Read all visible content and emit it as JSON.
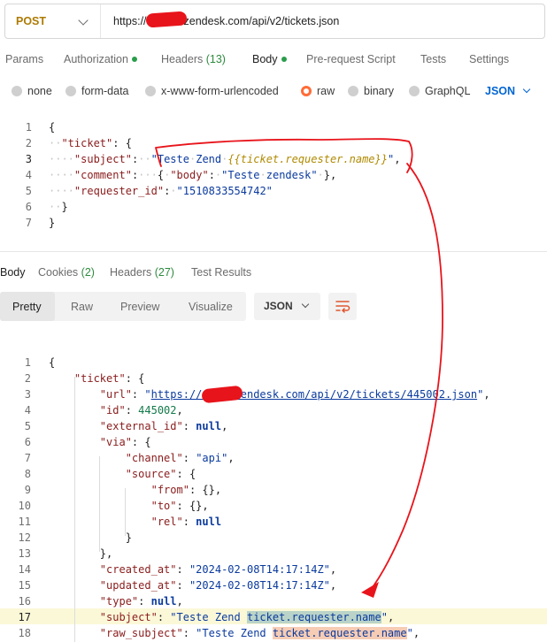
{
  "request": {
    "method": "POST",
    "url": "https://●●●●w.zendesk.com/api/v2/tickets.json"
  },
  "request_tabs": [
    {
      "label": "Params"
    },
    {
      "label": "Authorization",
      "dot": true
    },
    {
      "label": "Headers",
      "count": "(13)"
    },
    {
      "label": "Body",
      "dot": true,
      "active": true
    },
    {
      "label": "Pre-request Script"
    },
    {
      "label": "Tests"
    },
    {
      "label": "Settings"
    }
  ],
  "body_types": {
    "none": "none",
    "form_data": "form-data",
    "urlencoded": "x-www-form-urlencoded",
    "raw": "raw",
    "binary": "binary",
    "graphql": "GraphQL",
    "format": "JSON",
    "selected": "raw"
  },
  "request_body_lines": [
    "{",
    "  \"ticket\": {",
    "    \"subject\":  \"Teste Zend {{ticket.requester.name}}\",",
    "    \"comment\":   { \"body\": \"Teste zendesk\" },",
    "    \"requester_id\": \"1510833554742\"",
    "  }",
    "}"
  ],
  "response_tabs": [
    {
      "label": "Body",
      "active": true
    },
    {
      "label": "Cookies",
      "count": "(2)"
    },
    {
      "label": "Headers",
      "count": "(27)"
    },
    {
      "label": "Test Results"
    }
  ],
  "view_modes": [
    "Pretty",
    "Raw",
    "Preview",
    "Visualize"
  ],
  "response_format": "JSON",
  "response_lines": [
    "{",
    "    \"ticket\": {",
    "        \"url\": \"https://●●●●.zendesk.com/api/v2/tickets/445002.json\",",
    "        \"id\": 445002,",
    "        \"external_id\": null,",
    "        \"via\": {",
    "            \"channel\": \"api\",",
    "            \"source\": {",
    "                \"from\": {},",
    "                \"to\": {},",
    "                \"rel\": null",
    "            }",
    "        },",
    "        \"created_at\": \"2024-02-08T14:17:14Z\",",
    "        \"updated_at\": \"2024-02-08T14:17:14Z\",",
    "        \"type\": null,",
    "        \"subject\": \"Teste Zend ticket.requester.name\",",
    "        \"raw_subject\": \"Teste Zend ticket.requester.name\","
  ],
  "colors": {
    "accent": "#ff6c37",
    "method": "#ad7a03",
    "link": "#0265d2",
    "annotation": "#e8141b",
    "current_line": "#fbf8d8"
  }
}
